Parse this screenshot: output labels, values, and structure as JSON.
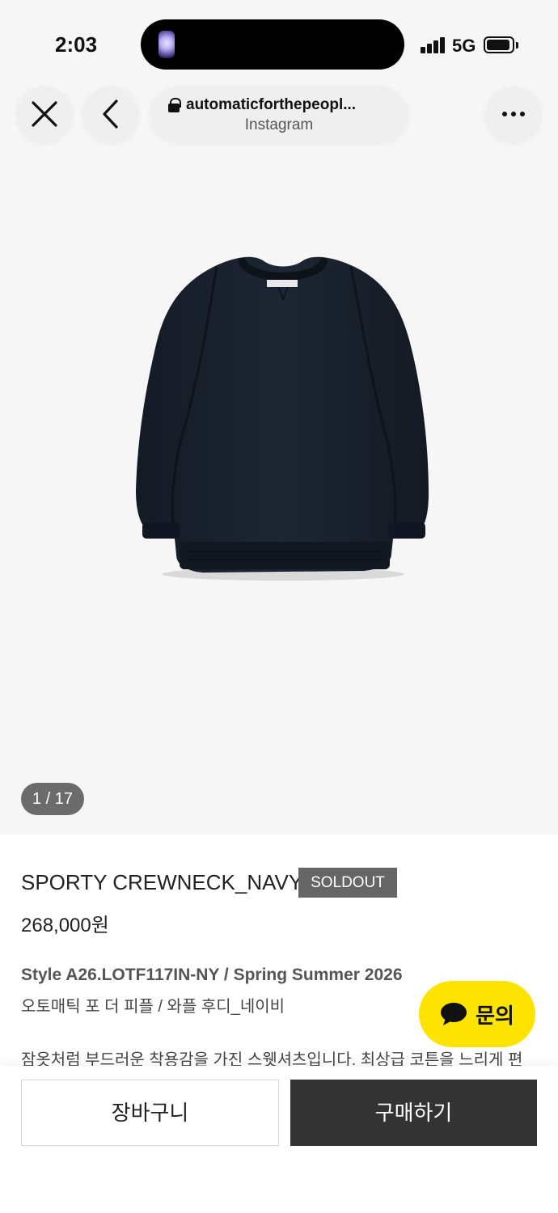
{
  "status_bar": {
    "time": "2:03",
    "network": "5G",
    "icons": [
      "flashlight-icon",
      "signal-icon",
      "battery-icon"
    ]
  },
  "browser": {
    "url": "automaticforthepeopl...",
    "source": "Instagram",
    "icons": [
      "close-icon",
      "back-chevron-icon",
      "lock-icon",
      "more-icon"
    ]
  },
  "gallery": {
    "counter": "1 / 17",
    "image_subject": "navy crewneck sweatshirt",
    "colors": {
      "garment": "#1b2330",
      "background": "#f6f6f6"
    }
  },
  "product": {
    "name": "SPORTY CREWNECK_NAVY",
    "badge": "SOLDOUT",
    "price": "268,000원",
    "style": "Style A26.LOTF117IN-NY / Spring Summer 2026",
    "brand_line": "오토매틱 포 더 피플 / 와플 후디_네이비",
    "description": "잠옷처럼 부드러운 착용감을 가진 스웻셔츠입니다. 최상급 코튼을 느리게 편"
  },
  "inquiry": {
    "label": "문의",
    "icon": "chat-bubble-icon",
    "color": "#fde300"
  },
  "actions": {
    "cart_label": "장바구니",
    "buy_label": "구매하기"
  }
}
